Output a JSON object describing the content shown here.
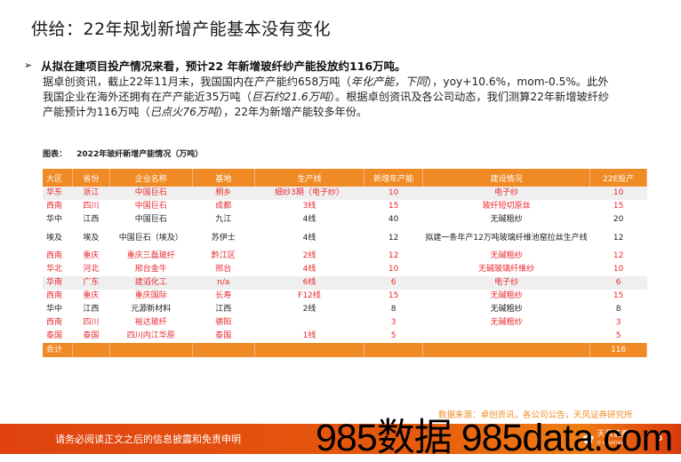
{
  "header": {
    "title": "供给：22年规划新增产能基本没有变化"
  },
  "bullet": {
    "icon": "arrow-bullet-icon",
    "glyph": "➢",
    "text": "从拟在建项目投产情况来看，预计22 年新增玻纤纱产能投放约116万吨。"
  },
  "body": {
    "p1": "据卓创资讯，截止22年11月末，我国国内在产产能约658万吨（",
    "p1_italic": "年化产能，下同",
    "p2": "），yoy+10.6%，mom-0.5%。此外我国企业在海外还拥有在产产能近35万吨（",
    "p2_italic": "巨石约21.6万吨",
    "p3": "）。根据卓创资讯及各公司动态，我们测算22年新增玻纤纱产能预计为116万吨（",
    "p3_italic": "已点火76万吨",
    "p4": "），22年为新增产能较多年份。"
  },
  "figure": {
    "label": "图表：",
    "caption": "2022年玻纤新增产能情况（万吨）"
  },
  "table": {
    "headers": [
      "大区",
      "省份",
      "企业名称",
      "基地",
      "生产线",
      "新增年产能",
      "建设情况",
      "22E投产"
    ],
    "rows": [
      {
        "cells": [
          "华东",
          "浙江",
          "中国巨石",
          "桐乡",
          "细纱3期（电子纱）",
          "10",
          "电子纱",
          "10"
        ],
        "color": "red",
        "shaded": true
      },
      {
        "cells": [
          "西南",
          "四川",
          "中国巨石",
          "成都",
          "3线",
          "15",
          "玻纤短切原丝",
          "15"
        ],
        "color": "red",
        "shaded": false
      },
      {
        "cells": [
          "华中",
          "江西",
          "中国巨石",
          "九江",
          "4线",
          "40",
          "无碱粗纱",
          "20"
        ],
        "color": "black",
        "shaded": false
      },
      {
        "cells": [
          "埃及",
          "埃及",
          "中国巨石（埃及）",
          "苏伊士",
          "4线",
          "12",
          "拟建一条年产12万吨玻璃纤维池窑拉丝生产线",
          "12"
        ],
        "color": "black",
        "shaded": false
      },
      {
        "cells": [
          "西南",
          "重庆",
          "重庆三磊玻纤",
          "黔江区",
          "2线",
          "12",
          "无碱粗纱",
          "12"
        ],
        "color": "red",
        "shaded": false
      },
      {
        "cells": [
          "华北",
          "河北",
          "邢台金牛",
          "邢台",
          "4线",
          "10",
          "无碱玻璃纤维纱",
          "10"
        ],
        "color": "red",
        "shaded": false
      },
      {
        "cells": [
          "华南",
          "广东",
          "建滔化工",
          "n/a",
          "6线",
          "6",
          "电子纱",
          "6"
        ],
        "color": "red",
        "shaded": true
      },
      {
        "cells": [
          "西南",
          "重庆",
          "重庆国际",
          "长寿",
          "F12线",
          "15",
          "无碱粗纱",
          "15"
        ],
        "color": "red",
        "shaded": false
      },
      {
        "cells": [
          "华中",
          "江西",
          "元源新材料",
          "江西",
          "2线",
          "8",
          "无碱粗纱",
          "8"
        ],
        "color": "black",
        "shaded": false
      },
      {
        "cells": [
          "西南",
          "四川",
          "裕达玻纤",
          "德阳",
          "",
          "3",
          "无碱粗纱",
          "3"
        ],
        "color": "red",
        "shaded": false
      },
      {
        "cells": [
          "泰国",
          "泰国",
          "四川内江华原",
          "泰国",
          "1线",
          "5",
          "",
          "5"
        ],
        "color": "red",
        "shaded": false
      }
    ],
    "total": {
      "label": "合计",
      "value": "116"
    }
  },
  "source": "数据来源：卓创资讯，各公司公告，天风证券研究所",
  "footer": {
    "disclaimer": "请务必阅读正文之后的信息披露和免责申明",
    "logo_name": "天风证券",
    "logo_sub": "TF SECURITIES",
    "page_number": "5"
  },
  "watermark": "985数据 985data.com",
  "colors": {
    "accent_orange": "#f08a24",
    "highlight_red": "#e8292e",
    "footer_red": "#e0420e"
  }
}
